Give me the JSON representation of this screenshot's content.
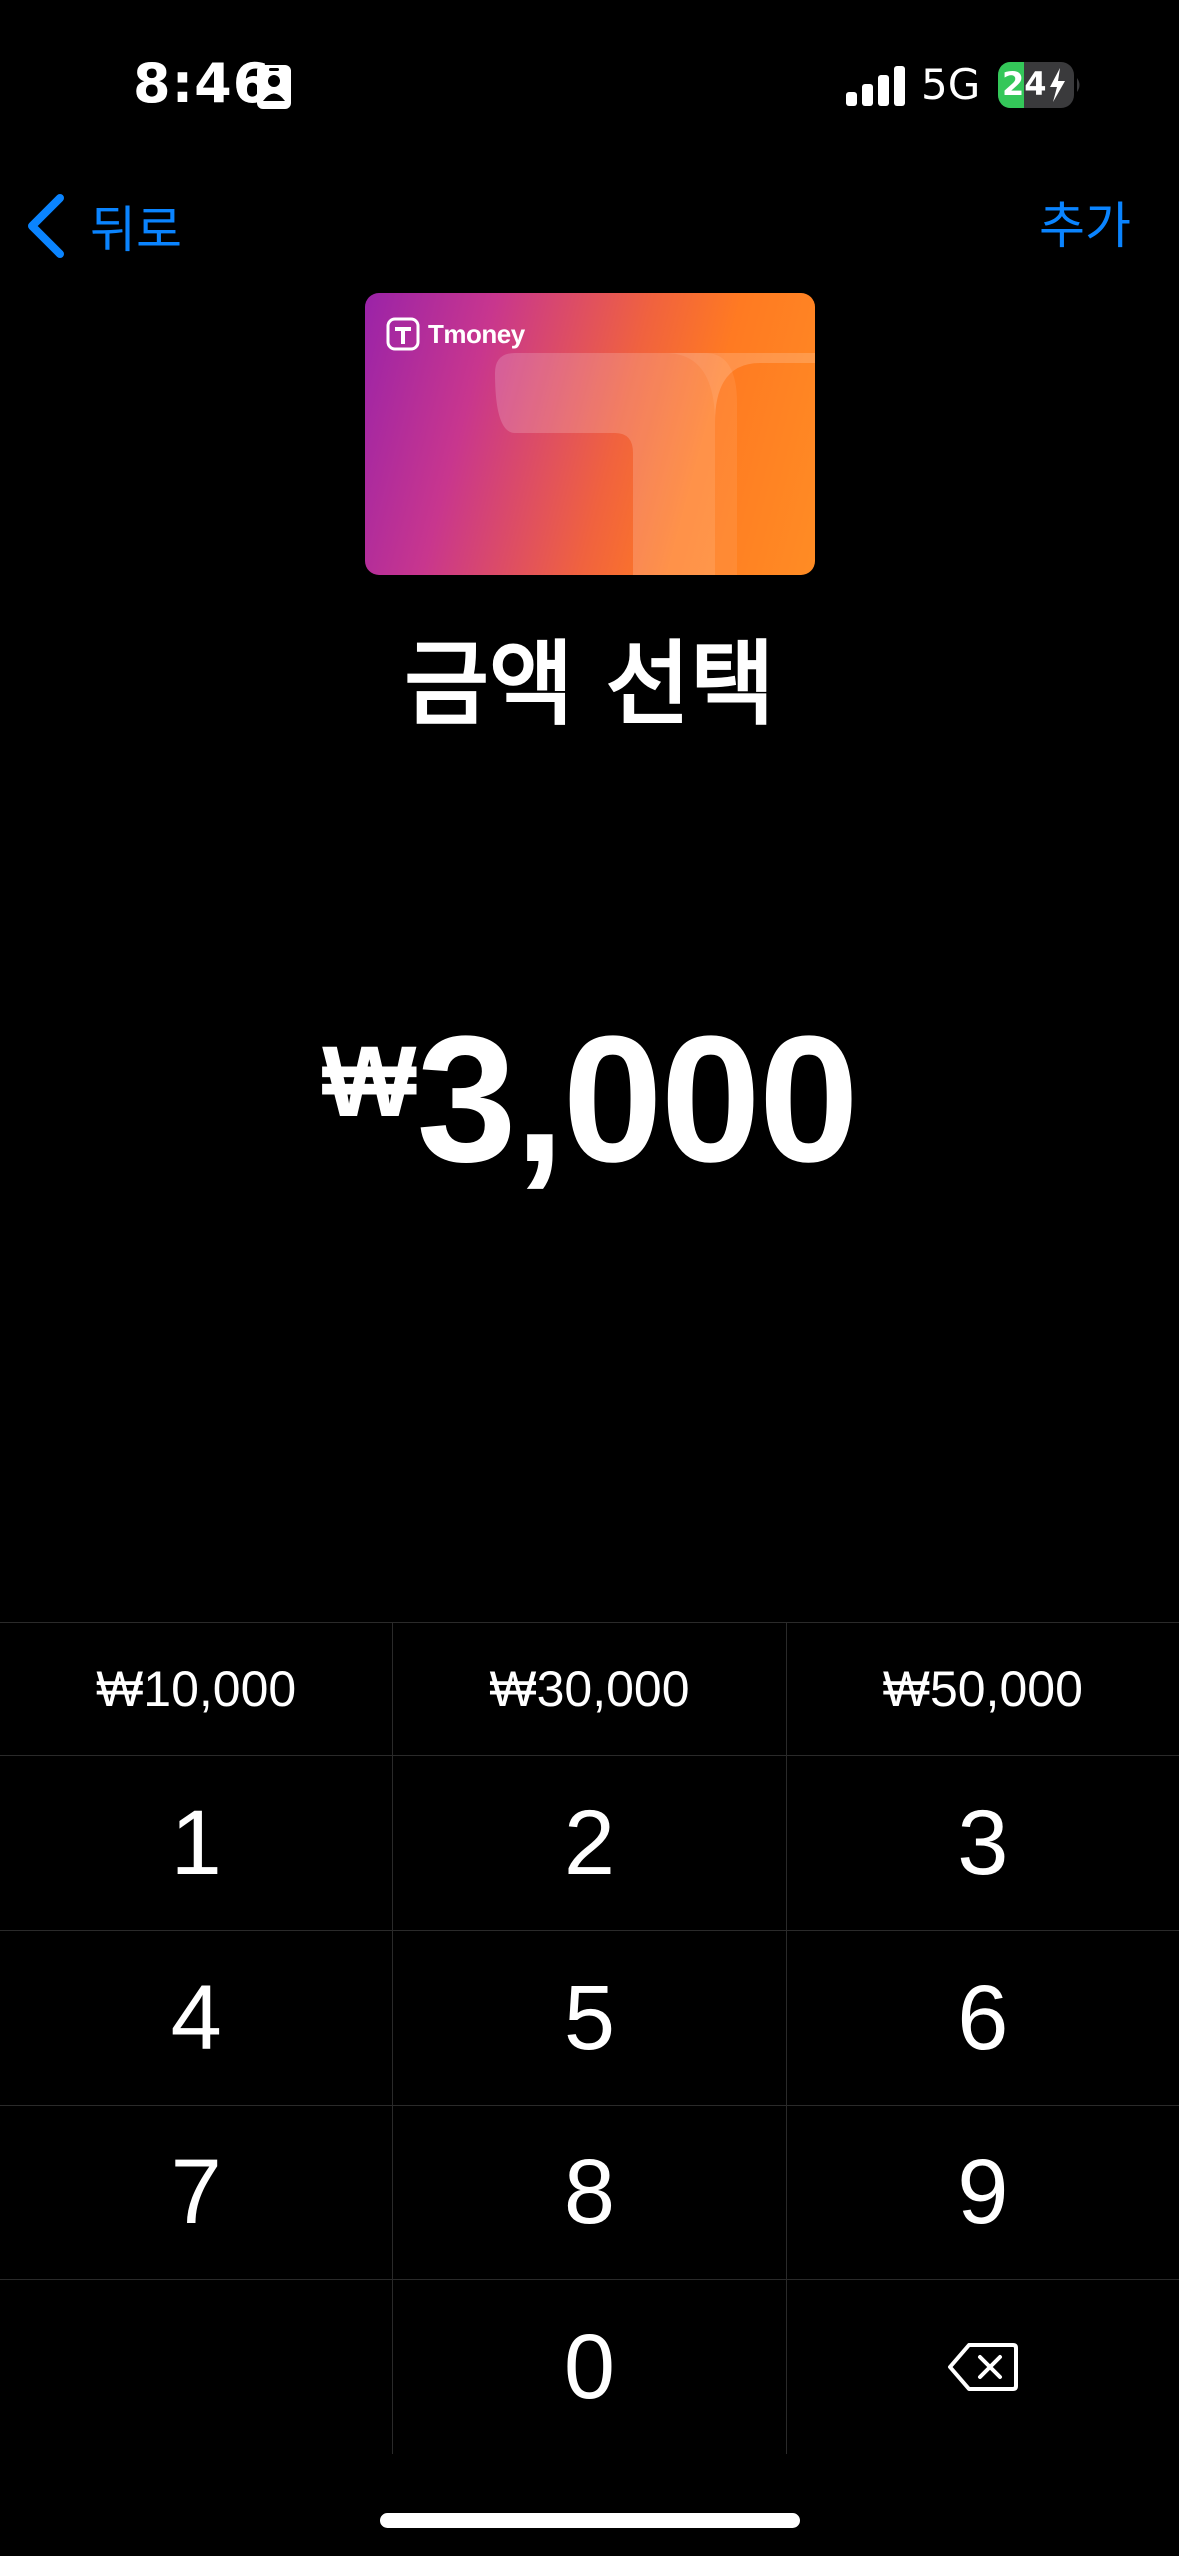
{
  "status_bar": {
    "time": "8:46",
    "network": "5G",
    "battery": "24",
    "icons": [
      "id-card-icon",
      "signal-icon",
      "battery-charging-icon"
    ]
  },
  "nav": {
    "back_label": "뒤로",
    "add_label": "추가",
    "accent_color": "#0a84ff"
  },
  "card": {
    "brand": "Tmoney",
    "logo_icon": "tmoney-logo-icon"
  },
  "title": "금액 선택",
  "amount": {
    "currency": "₩",
    "value": "3,000"
  },
  "presets": [
    "₩10,000",
    "₩30,000",
    "₩50,000"
  ],
  "keypad": {
    "rows": [
      [
        "1",
        "2",
        "3"
      ],
      [
        "4",
        "5",
        "6"
      ],
      [
        "7",
        "8",
        "9"
      ]
    ],
    "zero": "0",
    "delete_icon": "delete-backspace-icon"
  }
}
